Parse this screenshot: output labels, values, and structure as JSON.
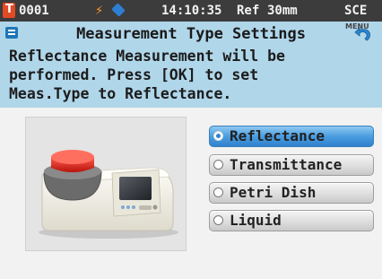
{
  "status_bar": {
    "sample_icon": "target-sample-icon",
    "sample_number": "0001",
    "power_icon": "lightning-bolt-icon",
    "probe_icon": "diamond-probe-icon",
    "time": "14:10:35",
    "reference": "Ref",
    "aperture": "30mm",
    "mode": "SCE"
  },
  "header": {
    "icon": "settings-list-icon",
    "title": "Measurement Type Settings",
    "menu_label": "MENU",
    "back_icon": "back-arrow-icon"
  },
  "message": "Reflectance Measurement will be\nperformed. Press [OK] to set\nMeas.Type to Reflectance.",
  "device_illustration": "spectrophotometer-device-icon",
  "options": [
    {
      "label": "Reflectance",
      "selected": true
    },
    {
      "label": "Transmittance",
      "selected": false
    },
    {
      "label": "Petri Dish",
      "selected": false
    },
    {
      "label": "Liquid",
      "selected": false
    }
  ],
  "colors": {
    "status_bar_bg": "#3c3c3c",
    "header_bg": "#b0d6ea",
    "selected_option": "#4a9de0",
    "accent_orange": "#ff9a1f",
    "accent_red": "#e04a24"
  }
}
